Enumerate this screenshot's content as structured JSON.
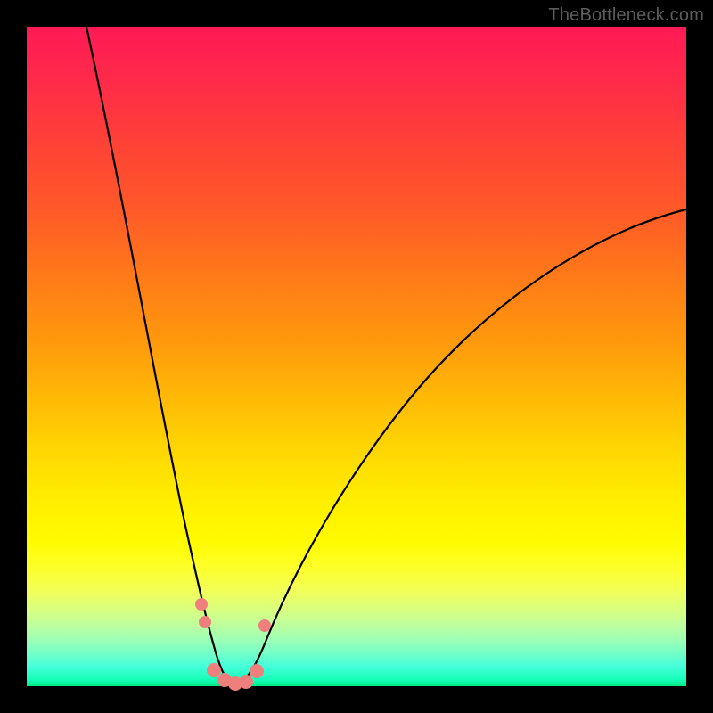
{
  "watermark": "TheBottleneck.com",
  "chart_data": {
    "type": "line",
    "title": "",
    "xlabel": "",
    "ylabel": "",
    "xlim": [
      0,
      100
    ],
    "ylim": [
      0,
      100
    ],
    "series": [
      {
        "name": "bottleneck-curve",
        "x": [
          9,
          12,
          15,
          18,
          20,
          22,
          24,
          25,
          26,
          27,
          28,
          29,
          30,
          31,
          32,
          33,
          35,
          38,
          42,
          48,
          55,
          63,
          72,
          82,
          92,
          100
        ],
        "y": [
          100,
          85,
          70,
          55,
          44,
          34,
          24,
          18,
          12,
          7,
          3,
          1,
          0,
          0,
          1,
          3,
          7,
          14,
          22,
          32,
          41,
          49,
          56,
          62,
          67,
          70
        ]
      }
    ],
    "markers": {
      "name": "highlight-dots",
      "x": [
        26.0,
        26.5,
        28.0,
        29.5,
        31.0,
        32.5,
        34.0,
        35.2
      ],
      "y": [
        12.0,
        9.0,
        1.5,
        0.5,
        0.5,
        1.0,
        3.5,
        9.0
      ]
    }
  }
}
